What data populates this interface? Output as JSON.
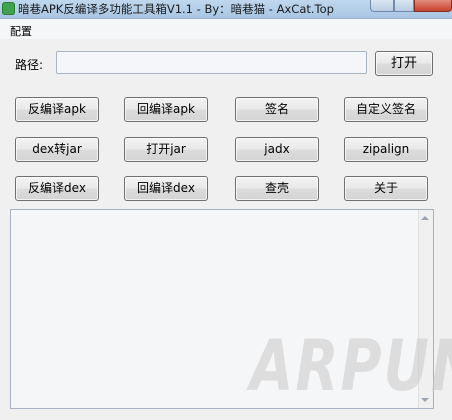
{
  "window": {
    "title": "暗巷APK反编译多功能工具箱V1.1 - By：暗巷猫 - AxCat.Top"
  },
  "menu": {
    "items": [
      {
        "label": "配置"
      }
    ]
  },
  "path": {
    "label": "路径:",
    "value": "",
    "placeholder": "",
    "open_label": "打开"
  },
  "buttons": {
    "row1": [
      "反编译apk",
      "回编译apk",
      "签名",
      "自定义签名"
    ],
    "row2": [
      "dex转jar",
      "打开jar",
      "jadx",
      "zipalign"
    ],
    "row3": [
      "反编译dex",
      "回编译dex",
      "查壳",
      "关于"
    ]
  },
  "output": {
    "text": ""
  },
  "watermark": "ARPUN",
  "colors": {
    "window_bg": "#f0f0f0",
    "titlebar": "#bfd8ee",
    "close_button": "#c4412c",
    "app_icon": "#3fa34d"
  },
  "icons": {
    "app": "app-icon",
    "scroll_up": "scroll-up-arrow-icon",
    "scroll_down": "scroll-down-arrow-icon"
  }
}
